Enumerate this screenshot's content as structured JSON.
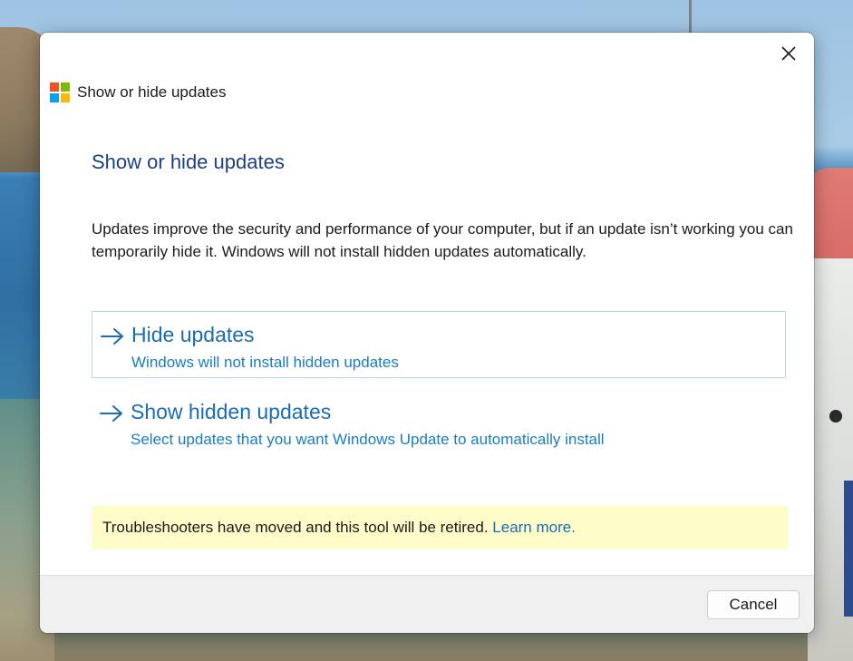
{
  "window": {
    "title": "Show or hide updates",
    "logo_icon": "windows-logo-icon",
    "logo_colors": [
      "#f25022",
      "#7fba00",
      "#00a4ef",
      "#ffb900"
    ],
    "close_icon": "close-icon"
  },
  "content": {
    "heading": "Show or hide updates",
    "description": "Updates improve the security and performance of your computer, but if an update isn’t working you can temporarily hide it. Windows will not install hidden updates automatically."
  },
  "options": [
    {
      "icon": "arrow-right-icon",
      "title": "Hide updates",
      "subtitle": "Windows will not install hidden updates"
    },
    {
      "icon": "arrow-right-icon",
      "title": "Show hidden updates",
      "subtitle": "Select updates that you want Windows Update to automatically install"
    }
  ],
  "notice": {
    "text": "Troubleshooters have moved and this tool will be retired.",
    "link": "Learn more."
  },
  "footer": {
    "cancel_label": "Cancel"
  },
  "colors": {
    "heading": "#1c3f86",
    "link": "#1a6db3",
    "notice_bg": "#fefcc8",
    "footer_bg": "#f0f0f0"
  }
}
